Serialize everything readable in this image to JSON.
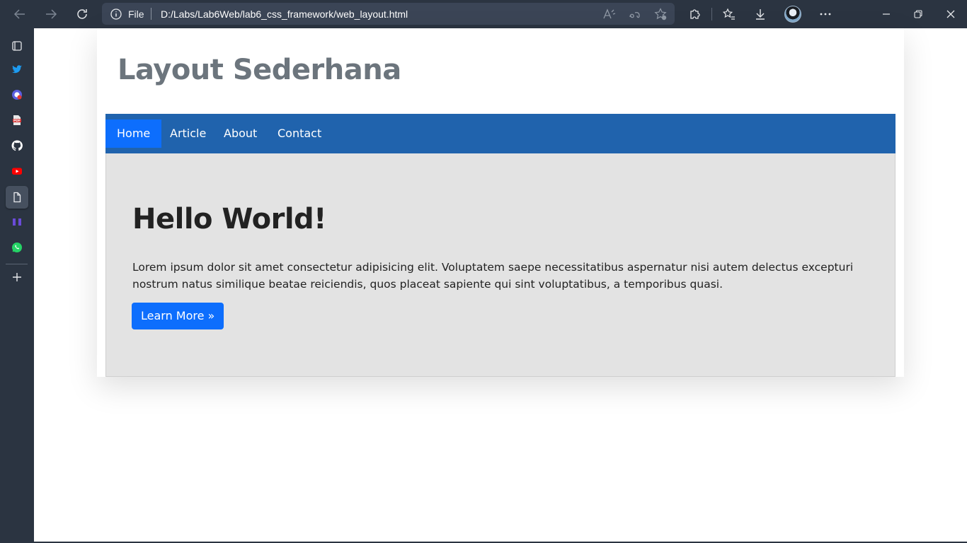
{
  "browser": {
    "address_scheme": "File",
    "address_url": "D:/Labs/Lab6Web/lab6_css_framework/web_layout.html"
  },
  "page": {
    "site_title": "Layout Sederhana",
    "nav": [
      {
        "label": "Home",
        "active": true
      },
      {
        "label": "Article",
        "active": false
      },
      {
        "label": "About",
        "active": false
      },
      {
        "label": "Contact",
        "active": false
      }
    ],
    "hero": {
      "heading": "Hello World!",
      "text": "Lorem ipsum dolor sit amet consectetur adipisicing elit. Voluptatem saepe necessitatibus aspernatur nisi autem delectus excepturi nostrum natus similique beatae reiciendis, quos placeat sapiente qui sint voluptatibus, a temporibus quasi.",
      "button_label": "Learn More »"
    }
  },
  "colors": {
    "chrome": "#2b3441",
    "navbar": "#2063ad",
    "accent": "#0d6efd",
    "hero_bg": "#e3e3e3",
    "title": "#6c757d"
  }
}
